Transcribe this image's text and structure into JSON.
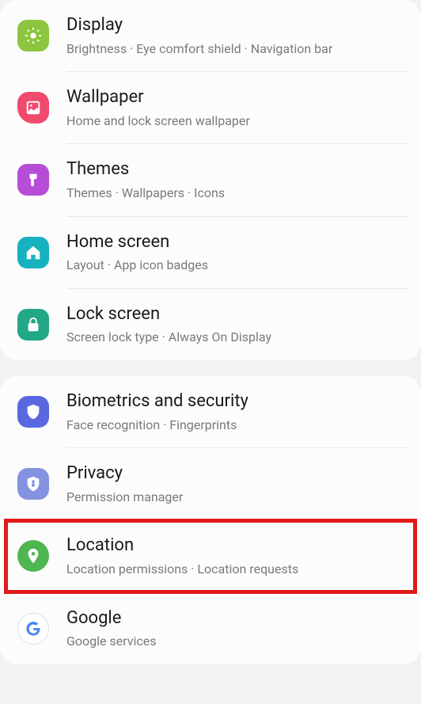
{
  "groups": [
    {
      "items": [
        {
          "icon": "display",
          "title": "Display",
          "subtitle": "Brightness  ·  Eye comfort shield  ·  Navigation bar"
        },
        {
          "icon": "wallpaper",
          "title": "Wallpaper",
          "subtitle": "Home and lock screen wallpaper"
        },
        {
          "icon": "themes",
          "title": "Themes",
          "subtitle": "Themes  ·  Wallpapers  ·  Icons"
        },
        {
          "icon": "home",
          "title": "Home screen",
          "subtitle": "Layout  ·  App icon badges"
        },
        {
          "icon": "lock",
          "title": "Lock screen",
          "subtitle": "Screen lock type  ·  Always On Display"
        }
      ]
    },
    {
      "items": [
        {
          "icon": "biometrics",
          "title": "Biometrics and security",
          "subtitle": "Face recognition  ·  Fingerprints"
        },
        {
          "icon": "privacy",
          "title": "Privacy",
          "subtitle": "Permission manager"
        },
        {
          "icon": "location",
          "title": "Location",
          "subtitle": "Location permissions  ·  Location requests",
          "highlight": true
        },
        {
          "icon": "google",
          "title": "Google",
          "subtitle": "Google services"
        }
      ]
    }
  ]
}
